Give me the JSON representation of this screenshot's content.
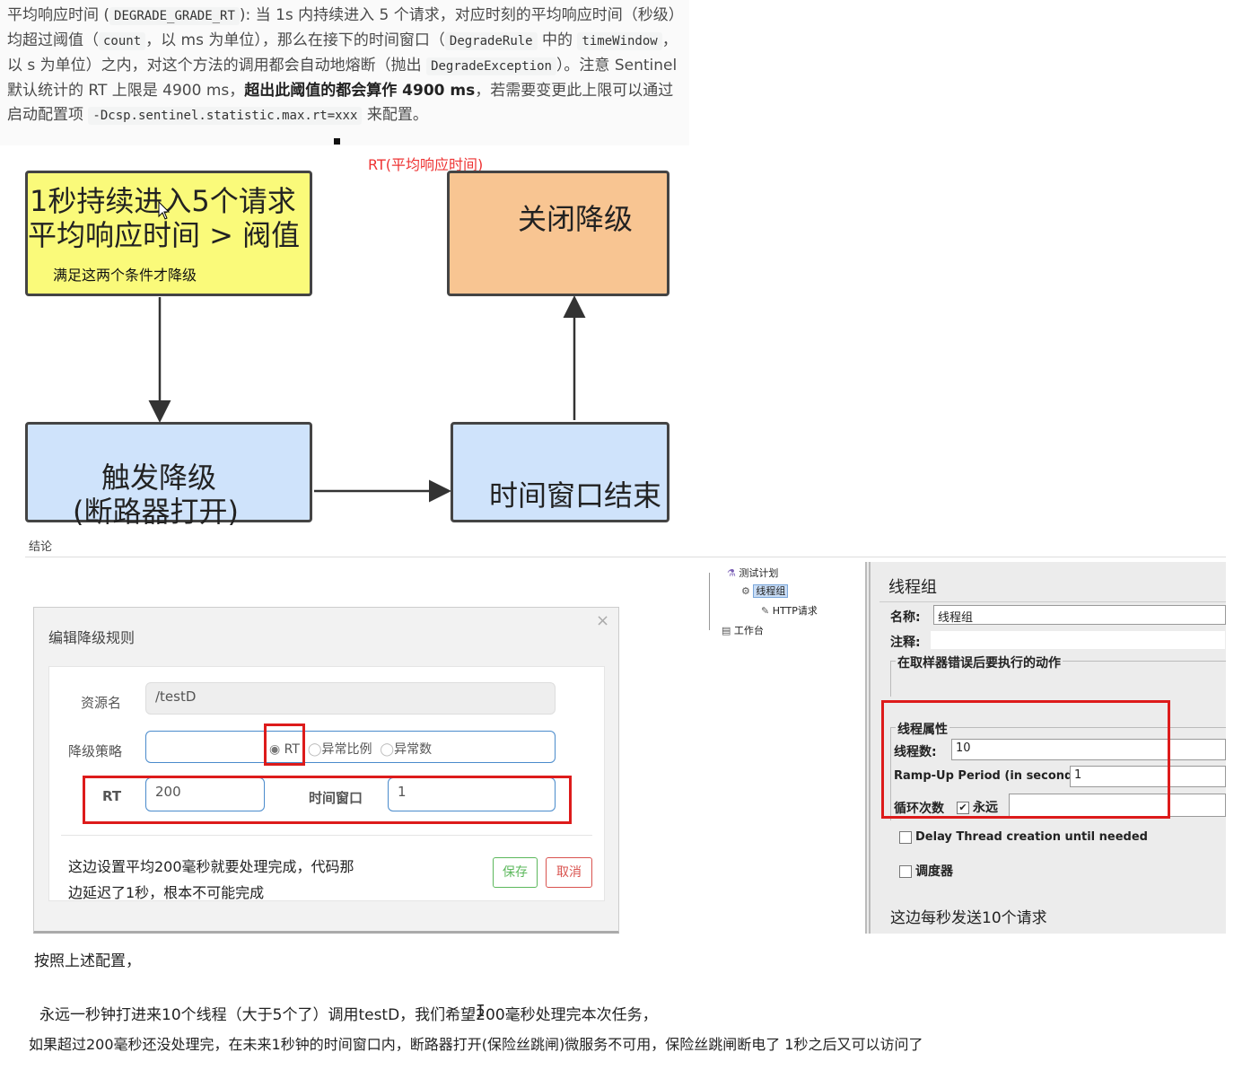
{
  "intro": {
    "p1": "平均响应时间 (",
    "c1": "DEGRADE_GRADE_RT",
    "p2": "): 当 1s 内持续进入 5 个请求，对应时刻的平均响应时间（秒级）均超过阈值（",
    "c2": "count",
    "p3": "，以 ms 为单位），那么在接下的时间窗口（",
    "c3": "DegradeRule",
    "p4": " 中的 ",
    "c4": "timeWindow",
    "p5": "，以 s 为单位）之内，对这个方法的调用都会自动地熔断（抛出 ",
    "c5": "DegradeException",
    "p6": "）。注意 Sentinel 默认统计的 RT 上限是 4900 ms，",
    "bold": "超出此阈值的都会算作 4900 ms",
    "p7": "，若需要变更此上限可以通过启动配置项 ",
    "c6": "-Dcsp.sentinel.statistic.max.rt=xxx",
    "p8": " 来配置。"
  },
  "diagram": {
    "annotation": "RT(平均响应时间)",
    "yellow_line1": "1秒持续进入5个请求",
    "yellow_line2": "平均响应时间 > 阀值",
    "yellow_note": "满足这两个条件才降级",
    "orange": "关闭降级",
    "blue1_line1": "触发降级",
    "blue1_line2": "(断路器打开)",
    "blue2": "时间窗口结束"
  },
  "conclusion_label": "结论",
  "dialog": {
    "title": "编辑降级规则",
    "close": "×",
    "resource_label": "资源名",
    "resource_value": "/testD",
    "strategy_label": "降级策略",
    "options": [
      "RT",
      "异常比例",
      "异常数"
    ],
    "rt_label": "RT",
    "rt_value": "200",
    "window_label": "时间窗口",
    "window_value": "1",
    "note_line1": "这边设置平均200毫秒就要处理完成，代码那",
    "note_line2": "边延迟了1秒，根本不可能完成",
    "save": "保存",
    "cancel": "取消"
  },
  "jmeter": {
    "tree": [
      "测试计划",
      "线程组",
      "HTTP请求",
      "工作台"
    ],
    "panel_title": "线程组",
    "name_label": "名称:",
    "name_value": "线程组",
    "comment_label": "注释:",
    "error_action": "在取样器错误后要执行的动作",
    "thread_props": "线程属性",
    "threads_label": "线程数:",
    "threads_value": "10",
    "rampup_label": "Ramp-Up Period (in seconds):",
    "rampup_value": "1",
    "loop_label": "循环次数",
    "forever": "永远",
    "delay_label": "Delay Thread creation until needed",
    "scheduler_label": "调度器",
    "note": "这边每秒发送10个请求"
  },
  "footer": {
    "line1": "按照上述配置，",
    "line2": "永远一秒钟打进来10个线程（大于5个了）调用testD，我们希望200毫秒处理完本次任务，",
    "line3": "如果超过200毫秒还没处理完，在未来1秒钟的时间窗口内，断路器打开(保险丝跳闸)微服务不可用，保险丝跳闸断电了 1秒之后又可以访问了"
  }
}
